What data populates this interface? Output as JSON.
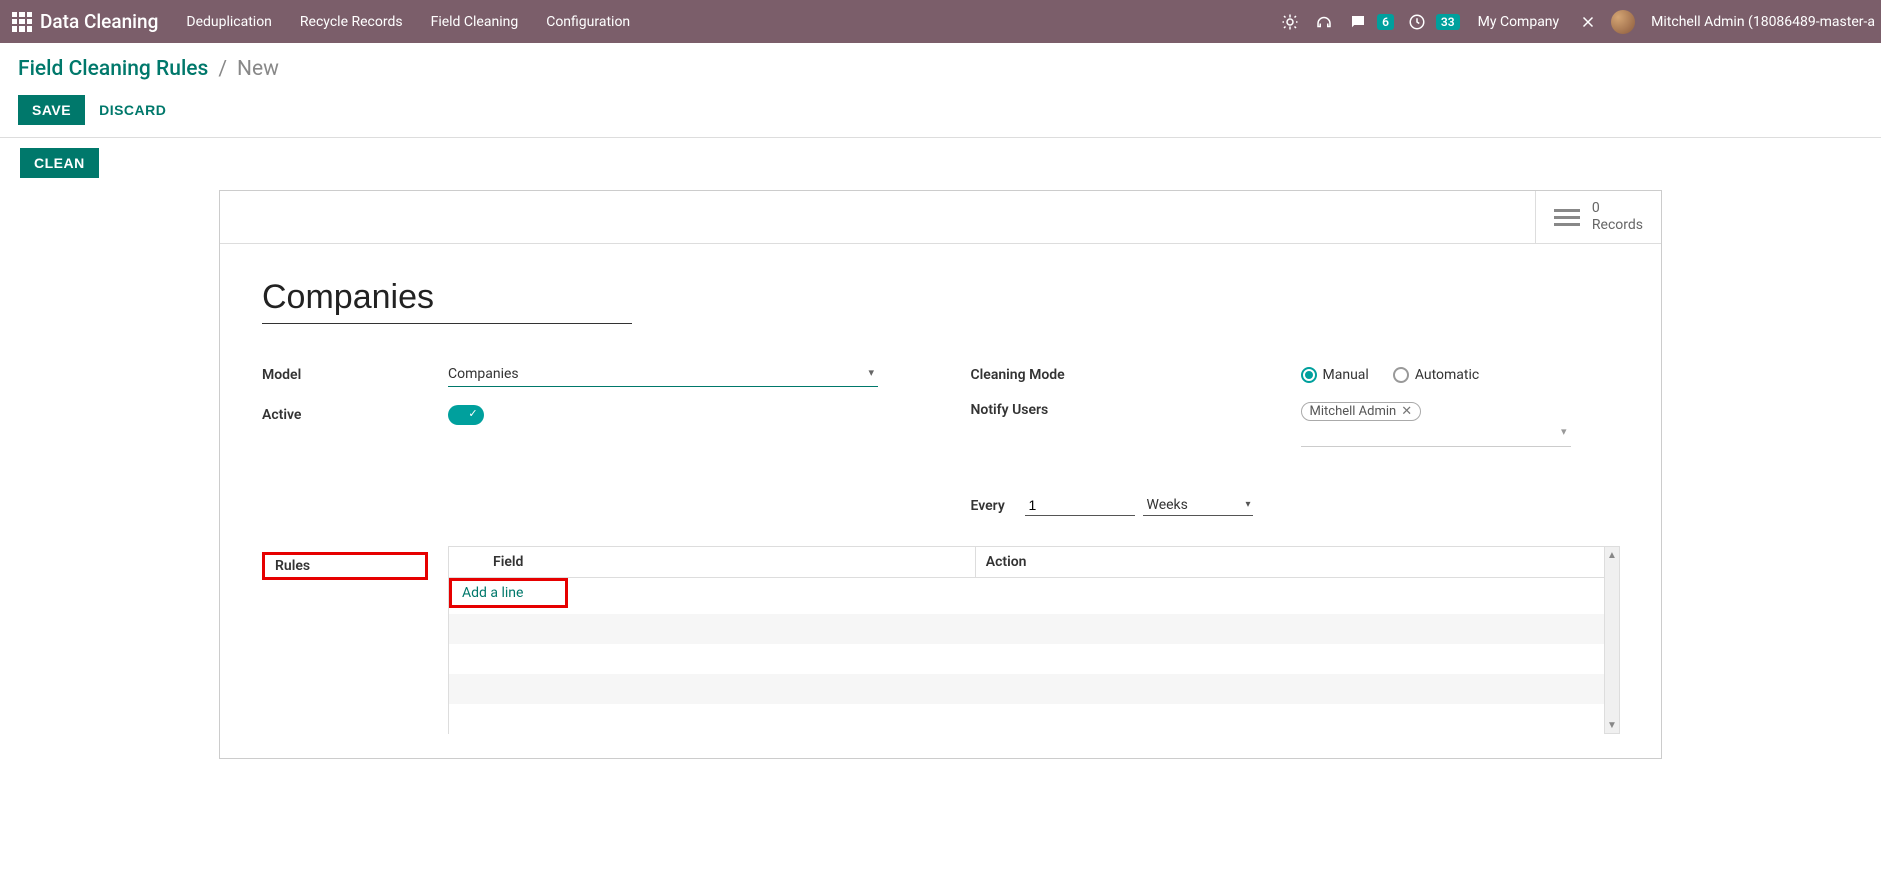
{
  "topbar": {
    "brand": "Data Cleaning",
    "nav": [
      "Deduplication",
      "Recycle Records",
      "Field Cleaning",
      "Configuration"
    ],
    "messages_badge": "6",
    "activities_badge": "33",
    "company": "My Company",
    "user": "Mitchell Admin (18086489-master-a"
  },
  "breadcrumb": {
    "parent": "Field Cleaning Rules",
    "current": "New"
  },
  "buttons": {
    "save": "SAVE",
    "discard": "DISCARD",
    "clean": "CLEAN"
  },
  "stat": {
    "count": "0",
    "label": "Records"
  },
  "form": {
    "title": "Companies",
    "labels": {
      "model": "Model",
      "active": "Active",
      "cleaning_mode": "Cleaning Mode",
      "notify_users": "Notify Users",
      "every": "Every"
    },
    "model_value": "Companies",
    "cleaning_mode": {
      "manual": "Manual",
      "automatic": "Automatic",
      "selected": "manual"
    },
    "notify_user_tag": "Mitchell Admin",
    "every_value": "1",
    "every_unit": "Weeks"
  },
  "rules": {
    "section_label": "Rules",
    "headers": {
      "field": "Field",
      "action": "Action"
    },
    "add_line": "Add a line"
  }
}
